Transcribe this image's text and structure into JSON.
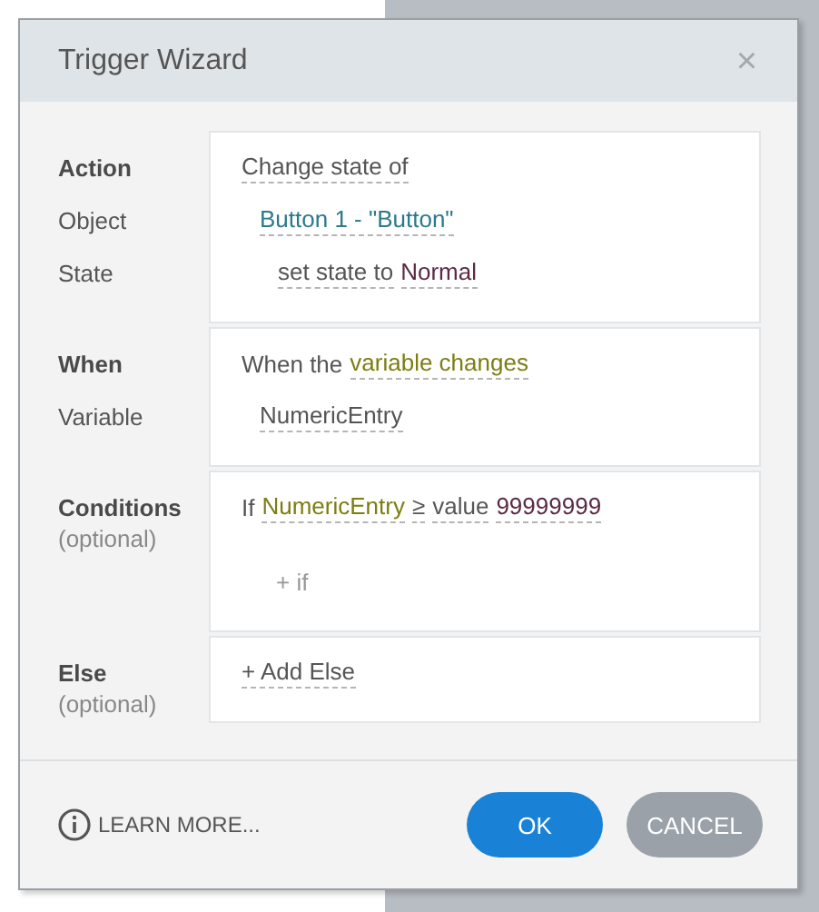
{
  "window": {
    "title": "Trigger Wizard",
    "close": "×"
  },
  "sections": [
    {
      "labels": [
        {
          "text": "Action",
          "kind": "heading"
        },
        {
          "text": "Object",
          "kind": "field"
        },
        {
          "text": "State",
          "kind": "field"
        }
      ],
      "lines": [
        {
          "kind": "plain",
          "tokens": [
            {
              "text": "Change state of",
              "kind": "choice"
            }
          ]
        },
        {
          "kind": "plain",
          "tokens": [
            {
              "text": "Button 1 - \"Button\"",
              "kind": "object"
            }
          ]
        },
        {
          "kind": "plain",
          "tokens": [
            {
              "text": "set state to",
              "kind": "choice"
            },
            {
              "text": "Normal",
              "kind": "value"
            }
          ]
        }
      ]
    },
    {
      "labels": [
        {
          "text": "When",
          "kind": "heading"
        },
        {
          "text": "Variable",
          "kind": "field"
        }
      ],
      "lines": [
        {
          "kind": "plain",
          "tokens": [
            {
              "text": "When the",
              "kind": "text"
            },
            {
              "text": "variable changes",
              "kind": "variable"
            }
          ]
        },
        {
          "kind": "plain",
          "tokens": [
            {
              "text": "NumericEntry",
              "kind": "choice"
            }
          ]
        }
      ]
    },
    {
      "labels": [
        {
          "text": "Conditions",
          "kind": "heading"
        },
        {
          "text": "(optional)",
          "kind": "hint"
        }
      ],
      "lines": [
        {
          "kind": "plain",
          "tokens": [
            {
              "text": "If",
              "kind": "text"
            },
            {
              "text": "NumericEntry",
              "kind": "variable"
            },
            {
              "text": "≥",
              "kind": "choice"
            },
            {
              "text": "value",
              "kind": "choice"
            },
            {
              "text": "99999999",
              "kind": "value"
            }
          ]
        },
        {
          "kind": "add",
          "tokens": [
            {
              "text": "+ if"
            }
          ]
        }
      ]
    },
    {
      "labels": [
        {
          "text": "Else",
          "kind": "heading"
        },
        {
          "text": "(optional)",
          "kind": "hint"
        }
      ],
      "lines": [
        {
          "kind": "plain",
          "tokens": [
            {
              "text": "+ Add Else",
              "kind": "choice"
            }
          ]
        }
      ]
    }
  ],
  "footer": {
    "learn_more": "LEARN MORE...",
    "buttons": [
      {
        "label": "OK",
        "kind": "primary"
      },
      {
        "label": "CANCEL",
        "kind": "secondary"
      }
    ]
  }
}
